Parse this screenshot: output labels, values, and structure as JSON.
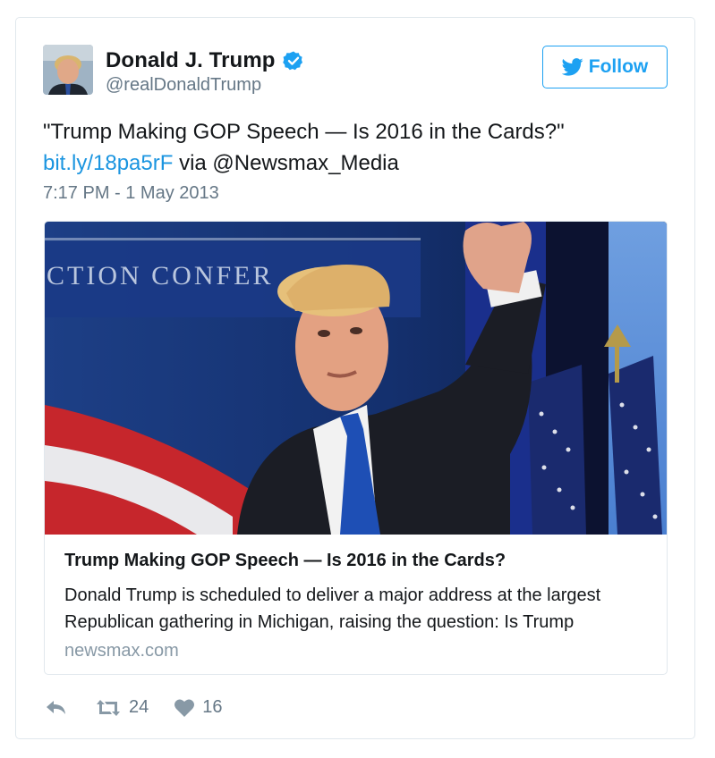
{
  "author": {
    "display_name": "Donald J. Trump",
    "handle": "@realDonaldTrump",
    "verified": true
  },
  "follow_button": {
    "label": "Follow",
    "icon": "twitter-bird-icon"
  },
  "tweet": {
    "text_line1": "\"Trump Making GOP Speech — Is 2016 in the Cards?\"",
    "link": "bit.ly/18pa5rF",
    "via": " via @Newsmax_Media",
    "timestamp": "7:17 PM - 1 May 2013"
  },
  "card": {
    "image_sign_text": "CTION CONFER",
    "title": "Trump Making GOP Speech — Is 2016 in the Cards?",
    "description": "Donald Trump is scheduled to deliver a major address at the largest Republican gathering in Michigan, raising the question: Is Trump",
    "domain": "newsmax.com"
  },
  "actions": {
    "reply_icon": "reply-icon",
    "retweet_icon": "retweet-icon",
    "retweet_count": "24",
    "like_icon": "heart-icon",
    "like_count": "16"
  },
  "colors": {
    "accent": "#1da1f2",
    "link": "#1b95e0",
    "muted": "#657786",
    "border": "#e1e8ed"
  }
}
